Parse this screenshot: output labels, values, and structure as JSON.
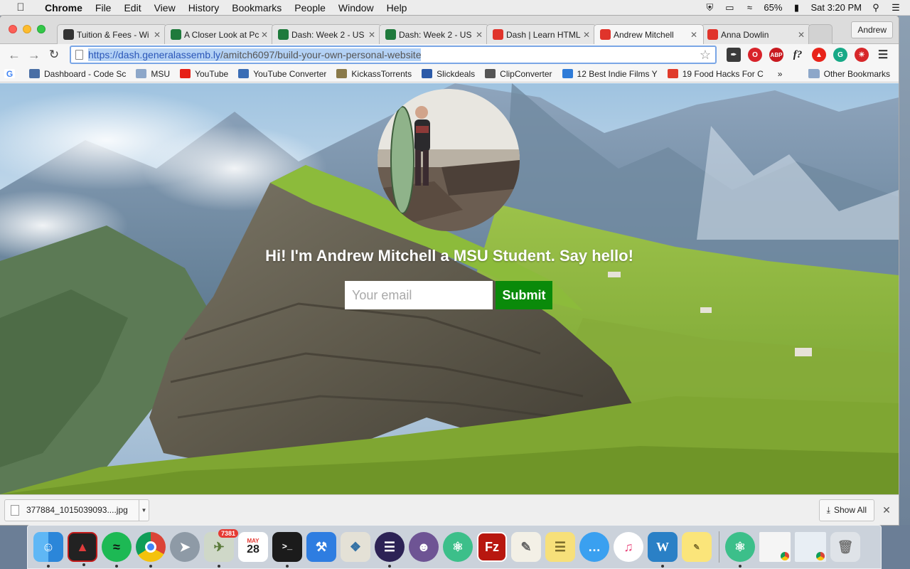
{
  "menubar": {
    "app_name": "Chrome",
    "items": [
      "File",
      "Edit",
      "View",
      "History",
      "Bookmarks",
      "People",
      "Window",
      "Help"
    ],
    "battery": "65%",
    "clock": "Sat 3:20 PM"
  },
  "tabs": [
    {
      "title": "Tuition & Fees - Wi",
      "icon": "globe-icon",
      "color": "#333333"
    },
    {
      "title": "A Closer Look at Pc",
      "icon": "s-logo-icon",
      "color": "#1f7a3c"
    },
    {
      "title": "Dash: Week 2 - US",
      "icon": "s-logo-icon",
      "color": "#1f7a3c"
    },
    {
      "title": "Dash: Week 2 - US",
      "icon": "s-logo-icon",
      "color": "#1f7a3c"
    },
    {
      "title": "Dash | Learn HTML",
      "icon": "ga-logo-icon",
      "color": "#e0342b"
    },
    {
      "title": "Andrew Mitchell",
      "icon": "ga-logo-icon",
      "color": "#e0342b",
      "active": true
    },
    {
      "title": "Anna Dowlin",
      "icon": "ga-logo-icon",
      "color": "#e0342b"
    }
  ],
  "profile_name": "Andrew",
  "omnibox": {
    "url_host": "https://dash.generalassemb.ly",
    "url_path": "/amitch6097/build-your-own-personal-website"
  },
  "bookmarks": [
    {
      "label": "Dashboard - Code Sc",
      "icon": "code-icon",
      "color": "#4a6fa5"
    },
    {
      "label": "MSU",
      "icon": "folder-icon",
      "color": "#8da7c9"
    },
    {
      "label": "YouTube",
      "icon": "youtube-icon",
      "color": "#e62117"
    },
    {
      "label": "YouTube Converter",
      "icon": "yt-mp3-icon",
      "color": "#3a6db5"
    },
    {
      "label": "KickassTorrents",
      "icon": "shield-icon",
      "color": "#8a7a4a"
    },
    {
      "label": "Slickdeals",
      "icon": "sd-icon",
      "color": "#2b5aa8"
    },
    {
      "label": "ClipConverter",
      "icon": "clip-icon",
      "color": "#555555"
    },
    {
      "label": "12 Best Indie Films Y",
      "icon": "a-icon",
      "color": "#2f7cd8"
    },
    {
      "label": "19 Food Hacks For C",
      "icon": "bf-icon",
      "color": "#e03b2b"
    }
  ],
  "bookmarks_overflow": "»",
  "other_bookmarks": "Other Bookmarks",
  "page": {
    "greeting": "Hi! I'm Andrew Mitchell a MSU Student. Say hello!",
    "email_placeholder": "Your email",
    "submit_label": "Submit",
    "submit_color": "#0a8a0a"
  },
  "download": {
    "filename": "377884_1015039093....jpg",
    "show_all": "Show All"
  },
  "dock": {
    "photos_badge": "7381",
    "calendar_month": "MAY",
    "calendar_day": "28"
  }
}
